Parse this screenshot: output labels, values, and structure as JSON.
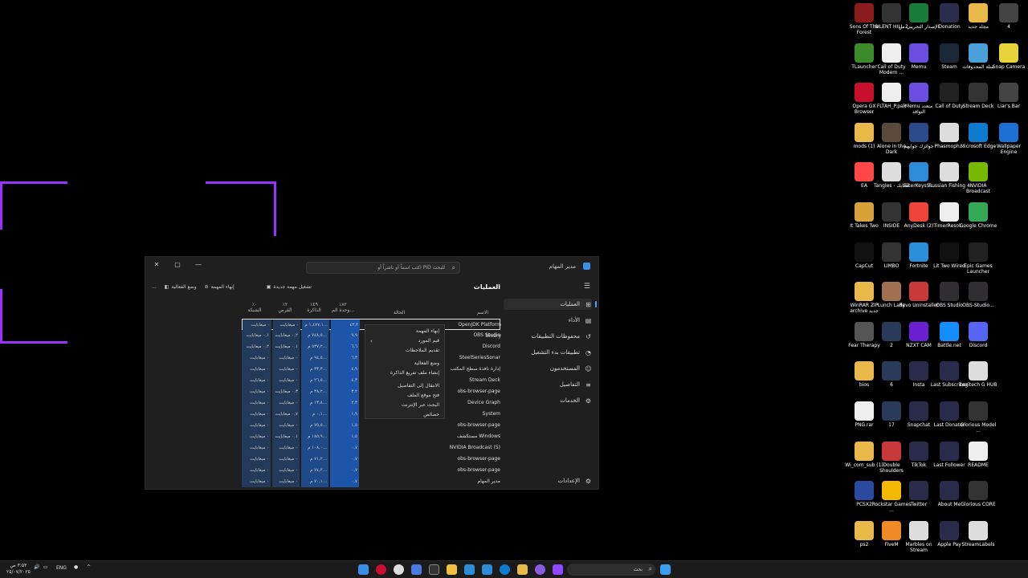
{
  "desktop_icons": [
    {
      "label": "Sons Of The Forest",
      "color": "#8b1a1a"
    },
    {
      "label": "SILENT HILL 2",
      "color": "#333333"
    },
    {
      "label": "الإصدار التجريبي من",
      "color": "#1a7a3a"
    },
    {
      "label": "Donation",
      "color": "#2c2c4c"
    },
    {
      "label": "مجلد جديد",
      "color": "#e8b84a"
    },
    {
      "label": "4",
      "color": "#444444"
    },
    {
      "label": "TLauncher",
      "color": "#3d8a2a"
    },
    {
      "label": "Call of Duty Modern ...",
      "color": "#eeeeee"
    },
    {
      "label": "Memu",
      "color": "#6b4de0"
    },
    {
      "label": "Steam",
      "color": "#1b2838"
    },
    {
      "label": "سلة المحذوفات",
      "color": "#4aa0d8"
    },
    {
      "label": "Snap Camera",
      "color": "#e6d33a"
    },
    {
      "label": "Opera GX Browser",
      "color": "#c8102e"
    },
    {
      "label": "FLTAH_P.pak",
      "color": "#eeeeee"
    },
    {
      "label": "Memu متعدد النوافذ",
      "color": "#6b4de0"
    },
    {
      "label": "Call of Duty",
      "color": "#222222"
    },
    {
      "label": "Stream Deck",
      "color": "#333333"
    },
    {
      "label": "Liar's Bar",
      "color": "#444444"
    },
    {
      "label": "mods (1)",
      "color": "#e8b84a"
    },
    {
      "label": "Alone in the Dark",
      "color": "#5a4a3a"
    },
    {
      "label": "جوائزك جوايهم",
      "color": "#2a4a8a"
    },
    {
      "label": "Phasmoph...",
      "color": "#dddddd"
    },
    {
      "label": "Microsoft Edge",
      "color": "#0f7bd0"
    },
    {
      "label": "Wallpaper Engine",
      "color": "#1d6fd3"
    },
    {
      "label": "EA",
      "color": "#ff4747"
    },
    {
      "label": "Tangles - تشابك",
      "color": "#dddddd"
    },
    {
      "label": "FilterKeysS...",
      "color": "#2e8bd8"
    },
    {
      "label": "Russian Fishing 4",
      "color": "#dddddd"
    },
    {
      "label": "NVIDIA Broadcast",
      "color": "#76b900"
    },
    {
      "label": "",
      "color": "#000000"
    },
    {
      "label": "It Takes Two",
      "color": "#d9a13a"
    },
    {
      "label": "INSIDE",
      "color": "#333333"
    },
    {
      "label": "AnyDesk (2)",
      "color": "#ef443b"
    },
    {
      "label": "TimerResol...",
      "color": "#eeeeee"
    },
    {
      "label": "Google Chrome",
      "color": "#34a853"
    },
    {
      "label": "",
      "color": "#000000"
    },
    {
      "label": "CapCut",
      "color": "#111111"
    },
    {
      "label": "LIMBO",
      "color": "#333333"
    },
    {
      "label": "Fortnite",
      "color": "#2b8ed8"
    },
    {
      "label": "Lit Two Wired",
      "color": "#111111"
    },
    {
      "label": "Epic Games Launcher",
      "color": "#222222"
    },
    {
      "label": "",
      "color": "#000000"
    },
    {
      "label": "WinRAR ZIP archive جديد",
      "color": "#e8b84a"
    },
    {
      "label": "Lunch Lady",
      "color": "#a07050"
    },
    {
      "label": "Revo Uninstaller",
      "color": "#c83a3a"
    },
    {
      "label": "OBS Studio",
      "color": "#302e31"
    },
    {
      "label": "OBS-Studio...",
      "color": "#302e31"
    },
    {
      "label": "",
      "color": "#000000"
    },
    {
      "label": "Fear Therapy",
      "color": "#555555"
    },
    {
      "label": "2",
      "color": "#2a3a5a"
    },
    {
      "label": "NZXT CAM",
      "color": "#6a1fd0"
    },
    {
      "label": "Battle.net",
      "color": "#148eff"
    },
    {
      "label": "Discord",
      "color": "#5865f2"
    },
    {
      "label": "",
      "color": "#000000"
    },
    {
      "label": "bios",
      "color": "#e8b84a"
    },
    {
      "label": "6",
      "color": "#2a3a5a"
    },
    {
      "label": "Insta",
      "color": "#2a2a4a"
    },
    {
      "label": "Last Subscriber",
      "color": "#2a2a4a"
    },
    {
      "label": "Logitech G HUB",
      "color": "#dddddd"
    },
    {
      "label": "",
      "color": "#000000"
    },
    {
      "label": "PNG.rar",
      "color": "#eeeeee"
    },
    {
      "label": "17",
      "color": "#2a3a5a"
    },
    {
      "label": "Snapchat",
      "color": "#2a2a4a"
    },
    {
      "label": "Last Donator",
      "color": "#2a2a4a"
    },
    {
      "label": "Glorious Model ...",
      "color": "#333333"
    },
    {
      "label": "",
      "color": "#000000"
    },
    {
      "label": "Wi_com_sub (1)",
      "color": "#e8b84a"
    },
    {
      "label": "Double Shoulders",
      "color": "#c83a3a"
    },
    {
      "label": "TikTok",
      "color": "#2a2a4a"
    },
    {
      "label": "Last Follower",
      "color": "#2a2a4a"
    },
    {
      "label": "README",
      "color": "#eeeeee"
    },
    {
      "label": "",
      "color": "#000000"
    },
    {
      "label": "PCSX2",
      "color": "#2a4aa0"
    },
    {
      "label": "Rockstar Games ...",
      "color": "#f5b800"
    },
    {
      "label": "Twitter",
      "color": "#2a2a4a"
    },
    {
      "label": "About Me",
      "color": "#2a2a4a"
    },
    {
      "label": "Glorious CORE",
      "color": "#333333"
    },
    {
      "label": "",
      "color": "#000000"
    },
    {
      "label": "ps2",
      "color": "#e8b84a"
    },
    {
      "label": "FiveM",
      "color": "#f08a24"
    },
    {
      "label": "Marbles on Stream",
      "color": "#dddddd"
    },
    {
      "label": "Apple Pay",
      "color": "#2a2a4a"
    },
    {
      "label": "StreamLabels",
      "color": "#dddddd"
    }
  ],
  "task_manager": {
    "app_name": "مدير المهام",
    "search_placeholder": "اكتب اسماً أو ناشراً أو PID للبحث",
    "heading": "العمليات",
    "toolbar": {
      "run_new_task": "تشغيل مهمة جديدة",
      "end_task": "إنهاء المهمة",
      "efficiency_mode": "وضع الفعالية",
      "more": "..."
    },
    "sidebar": [
      {
        "label": "العمليات",
        "icon": "grid-icon",
        "active": true
      },
      {
        "label": "الأداء",
        "icon": "chart-icon",
        "active": false
      },
      {
        "label": "محفوظات التطبيقات",
        "icon": "history-icon",
        "active": false
      },
      {
        "label": "تطبيقات بدء التشغيل",
        "icon": "startup-icon",
        "active": false
      },
      {
        "label": "المستخدمون",
        "icon": "users-icon",
        "active": false
      },
      {
        "label": "التفاصيل",
        "icon": "list-icon",
        "active": false
      },
      {
        "label": "الخدمات",
        "icon": "services-icon",
        "active": false
      }
    ],
    "settings_label": "الإعدادات",
    "columns": {
      "name": "الاسم",
      "status": "الحالة",
      "cpu_pct": "٪٨٢",
      "cpu": "وحدة الم...",
      "mem_pct": "٪٤٩",
      "mem": "الذاكرة",
      "disk_pct": "٪٢",
      "disk": "القرص",
      "net_pct": "٪٠",
      "net": "الشبكة"
    },
    "processes": [
      {
        "name": "OpenJDK Platform binary",
        "cpu": "٤٣,٣",
        "mem": "١,٤٧٧,١ م...",
        "disk": "٠ ميغابايت",
        "net": "٠ ميغابايت"
      },
      {
        "name": "OBS Studio",
        "cpu": "٩,٩",
        "mem": "٧٤٨,٥ م...",
        "disk": "٠,٢ ميغابايت",
        "net": "٠,١ ميغابايت"
      },
      {
        "name": "Discord",
        "cpu": "٦,٦",
        "mem": "٥٣٧,٢ م...",
        "disk": "٠,١ ميغابايت",
        "net": "٠,٢ ميغابايت"
      },
      {
        "name": "SteelSeriesSonar",
        "cpu": "٦,٣",
        "mem": "٩٤,٥ م...",
        "disk": "٠ ميغابايت",
        "net": "٠ ميغابايت"
      },
      {
        "name": "إدارة نافذة سطح المكتب",
        "cpu": "٤,٩",
        "mem": "٣٣,٣ م...",
        "disk": "٠ ميغابايت",
        "net": "٠ ميغابايت"
      },
      {
        "name": "Stream Deck",
        "cpu": "٤,٣",
        "mem": "٢٦,٥ م...",
        "disk": "٠ ميغابايت",
        "net": "٠ ميغابايت"
      },
      {
        "name": "obs-browser-page",
        "cpu": "٣,٢",
        "mem": "٣٨,٢ م...",
        "disk": "٠,٣ ميغابايت",
        "net": "٠ ميغابايت"
      },
      {
        "name": "Device Graph",
        "cpu": "٢,٣",
        "mem": "١٣,٨ م...",
        "disk": "٠ ميغابايت",
        "net": "٠ ميغابايت"
      },
      {
        "name": "System",
        "cpu": "١,٩",
        "mem": "٠,١ م...",
        "disk": "٠,٧ ميغابايت",
        "net": "٠ ميغابايت"
      },
      {
        "name": "obs-browser-page",
        "cpu": "١,٥",
        "mem": "٧٥,٥ م...",
        "disk": "٠ ميغابايت",
        "net": "٠ ميغابايت"
      },
      {
        "name": "مستكشف Windows",
        "cpu": "١,٥",
        "mem": "١٨٥,٩ م...",
        "disk": "٠,١ ميغابايت",
        "net": "٠ ميغابايت"
      },
      {
        "name": "NVIDIA Broadcast (5)",
        "cpu": "٠,٧",
        "mem": "١٠٨,٠ م...",
        "disk": "٠ ميغابايت",
        "net": "٠ ميغابايت"
      },
      {
        "name": "obs-browser-page",
        "cpu": "٠,٧",
        "mem": "٧١,٢ م...",
        "disk": "٠ ميغابايت",
        "net": "٠ ميغابايت"
      },
      {
        "name": "obs-browser-page",
        "cpu": "٠,٧",
        "mem": "٧٤,٢ م...",
        "disk": "٠ ميغابايت",
        "net": "٠ ميغابايت"
      },
      {
        "name": "مدير المهام",
        "cpu": "٠,٧",
        "mem": "٧٠,١ م...",
        "disk": "٠ ميغابايت",
        "net": "٠ ميغابايت"
      }
    ],
    "context_menu": [
      "إنهاء المهمة",
      "قيم المورد",
      "تقديم الملاحظات",
      "وضع الفعالية",
      "إنشاء ملف تفريغ الذاكرة",
      "الانتقال إلى التفاصيل",
      "فتح موقع الملف",
      "البحث عبر الإنترنت",
      "خصائص"
    ]
  },
  "taskbar": {
    "search_placeholder": "بحث",
    "language": "ENG",
    "time": "٣:٥٣ ص",
    "date": "٢٥/٠٧/٢٠٢٥"
  }
}
